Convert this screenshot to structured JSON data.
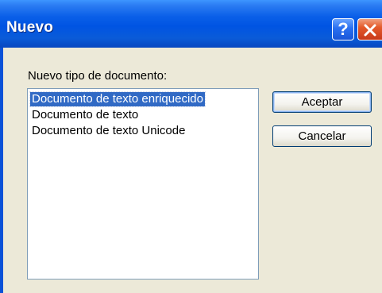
{
  "window": {
    "title": "Nuevo",
    "help_label": "?",
    "close_icon": "close-icon",
    "colors": {
      "titlebar": "#0054e3",
      "close": "#e45a2a",
      "body": "#ece9d8",
      "selection": "#316ac5"
    }
  },
  "dialog": {
    "label": "Nuevo tipo de documento:",
    "list": {
      "selected_index": 0,
      "items": [
        {
          "label": "Documento de texto enriquecido"
        },
        {
          "label": "Documento de texto"
        },
        {
          "label": "Documento de texto Unicode"
        }
      ]
    },
    "buttons": {
      "accept": "Aceptar",
      "cancel": "Cancelar"
    }
  }
}
